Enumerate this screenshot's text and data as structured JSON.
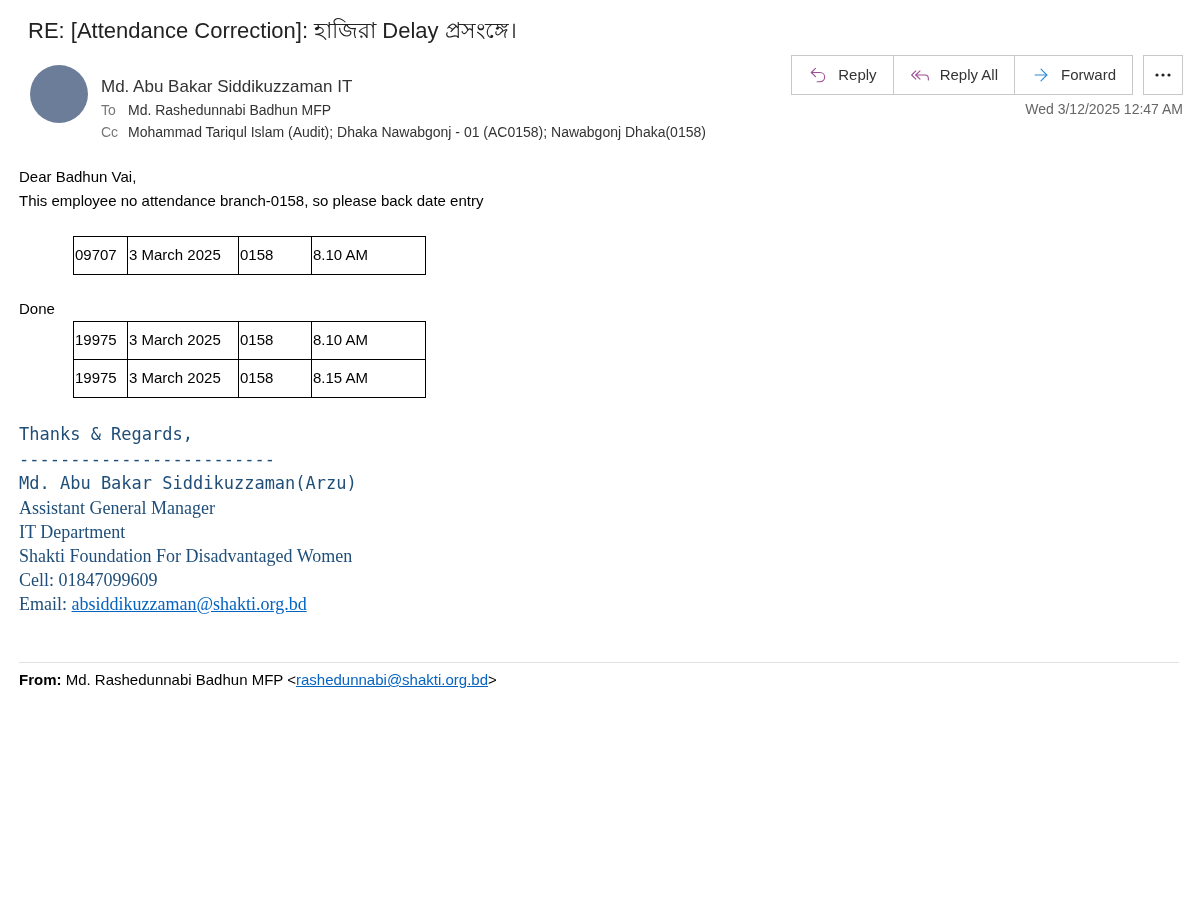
{
  "subject": "RE: [Attendance Correction]: হাজিরা Delay প্রসংঙ্গে।",
  "sender": {
    "name": "Md. Abu Bakar Siddikuzzaman IT",
    "to_label": "To",
    "to": "Md. Rashedunnabi Badhun MFP",
    "cc_label": "Cc",
    "cc": "Mohammad Tariqul Islam (Audit); Dhaka Nawabgonj - 01 (AC0158); Nawabgonj Dhaka(0158)"
  },
  "actions": [
    {
      "kind": "reply",
      "label": "Reply"
    },
    {
      "kind": "reply_all",
      "label": "Reply All"
    },
    {
      "kind": "forward",
      "label": "Forward"
    }
  ],
  "date": "Wed 3/12/2025 12:47 AM",
  "body": {
    "greeting": "Dear Badhun Vai,",
    "message": "This employee no attendance branch-0158, so please back date entry",
    "table_1": [
      [
        "09707",
        "3 March 2025",
        "0158",
        "8.10 AM"
      ]
    ],
    "done": "Done",
    "table_2": [
      [
        "19975",
        "3 March 2025",
        "0158",
        "8.10 AM"
      ],
      [
        "19975",
        "3 March 2025",
        "0158",
        "8.15 AM"
      ]
    ]
  },
  "signature": {
    "regards": "Thanks & Regards,",
    "rule": "-------------------------",
    "name": "Md. Abu Bakar Siddikuzzaman(Arzu)",
    "lines": [
      "Assistant General Manager",
      "IT Department",
      "Shakti Foundation For Disadvantaged Women",
      "Cell: 01847099609"
    ],
    "email_label": "Email: ",
    "email": "absiddikuzzaman@shakti.org.bd"
  },
  "quoted": {
    "from_label": "From:",
    "from_name": " Md. Rashedunnabi Badhun MFP <",
    "from_email": "rashedunnabi@shakti.org.bd",
    "from_close": ">"
  }
}
